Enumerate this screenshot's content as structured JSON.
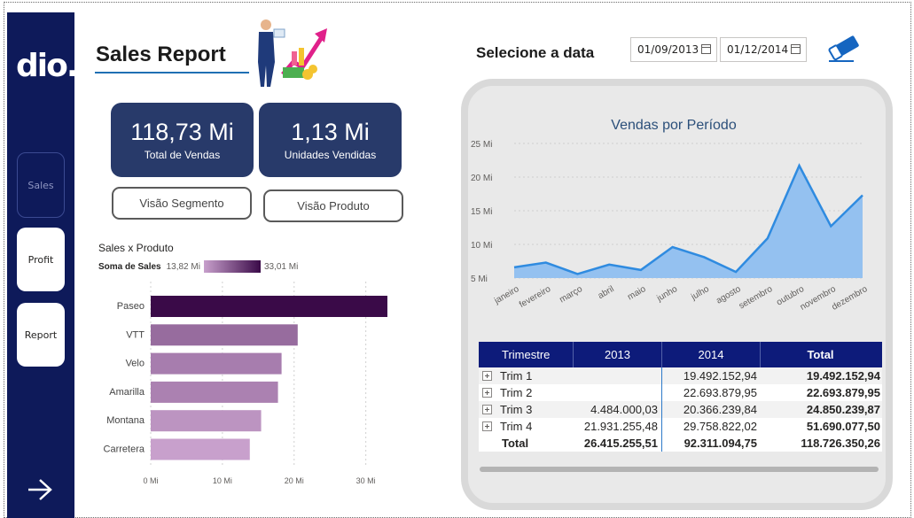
{
  "sidebar": {
    "logo": "dio.",
    "items": [
      {
        "label": "Sales"
      },
      {
        "label": "Profit"
      },
      {
        "label": "Report"
      }
    ]
  },
  "header": {
    "title": "Sales Report",
    "date_label": "Selecione a data",
    "date_start": "01/09/2013",
    "date_end": "01/12/2014"
  },
  "kpis": [
    {
      "value": "118,73 Mi",
      "label": "Total de Vendas"
    },
    {
      "value": "1,13 Mi",
      "label": "Unidades Vendidas"
    }
  ],
  "buttons": {
    "segment": "Visão Segmento",
    "product": "Visão Produto"
  },
  "bar_chart": {
    "title": "Sales x Produto",
    "legend_label": "Soma de  Sales",
    "legend_min": "13,82 Mi",
    "legend_max": "33,01 Mi"
  },
  "line_chart_title": "Vendas por Período",
  "colors": {
    "sidebar": "#0e1a5a",
    "kpi": "#283a6a",
    "table_header": "#0d1b7a",
    "line": "#2f8be0",
    "area": "#94c1f0"
  },
  "chart_data": [
    {
      "type": "bar",
      "title": "Sales x Produto",
      "categories": [
        "Paseo",
        "VTT",
        "Velo",
        "Amarilla",
        "Montana",
        "Carretera"
      ],
      "values": [
        33.01,
        20.5,
        18.25,
        17.75,
        15.4,
        13.82
      ],
      "xticks": [
        "0 Mi",
        "10 Mi",
        "20 Mi",
        "30 Mi"
      ],
      "xlim": [
        0,
        34
      ],
      "color_scale": [
        "#c8a0cc",
        "#3a0a48"
      ],
      "grid": true
    },
    {
      "type": "area",
      "title": "Vendas por Período",
      "categories": [
        "janeiro",
        "fevereiro",
        "março",
        "abril",
        "maio",
        "junho",
        "julho",
        "agosto",
        "setembro",
        "outubro",
        "novembro",
        "dezembro"
      ],
      "values": [
        6.6,
        7.3,
        5.6,
        7.0,
        6.2,
        9.6,
        8.1,
        5.9,
        10.9,
        21.7,
        12.7,
        17.3
      ],
      "yticks": [
        "5 Mi",
        "10 Mi",
        "15 Mi",
        "20 Mi",
        "25 Mi"
      ],
      "ylim": [
        5,
        25
      ],
      "grid": true
    }
  ],
  "table": {
    "headers": [
      "Trimestre",
      "2013",
      "2014",
      "Total"
    ],
    "rows": [
      {
        "label": "Trim 1",
        "y2013": "",
        "y2014": "19.492.152,94",
        "total": "19.492.152,94"
      },
      {
        "label": "Trim 2",
        "y2013": "",
        "y2014": "22.693.879,95",
        "total": "22.693.879,95"
      },
      {
        "label": "Trim 3",
        "y2013": "4.484.000,03",
        "y2014": "20.366.239,84",
        "total": "24.850.239,87"
      },
      {
        "label": "Trim 4",
        "y2013": "21.931.255,48",
        "y2014": "29.758.822,02",
        "total": "51.690.077,50"
      }
    ],
    "total_row": {
      "label": "Total",
      "y2013": "26.415.255,51",
      "y2014": "92.311.094,75",
      "total": "118.726.350,26"
    }
  }
}
